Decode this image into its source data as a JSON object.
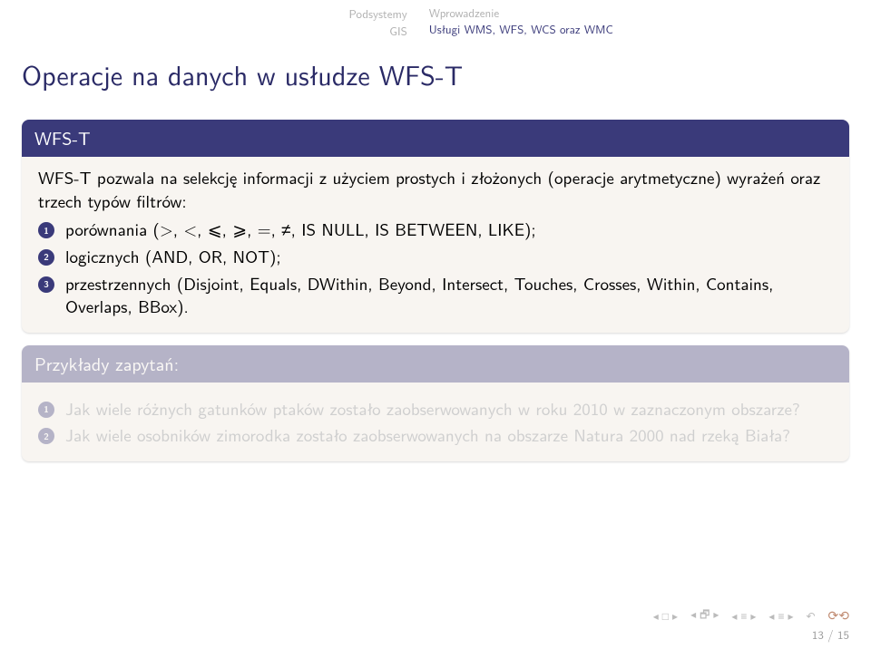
{
  "nav": {
    "left_line1": "Podsystemy",
    "left_line2": "GIS",
    "right_line1": "Wprowadzenie",
    "right_line2": "Usługi WMS, WFS, WCS oraz WMC"
  },
  "title": "Operacje na danych w usłudze WFS-T",
  "block1": {
    "title": "WFS-T",
    "intro": "WFS-T pozwala na selekcję informacji z użyciem prostych i złożonych (operacje arytmetyczne) wyrażeń oraz trzech typów filtrów:",
    "items": [
      "porównania (>, <, ⩽, ⩾, =, ≠, IS NULL, IS BETWEEN, LIKE);",
      "logicznych (AND, OR, NOT);",
      "przestrzennych (Disjoint, Equals, DWithin, Beyond, Intersect, Touches, Crosses, Within, Contains, Overlaps, BBox)."
    ]
  },
  "block2": {
    "title": "Przykłady zapytań:",
    "items": [
      "Jak wiele różnych gatunków ptaków zostało zaobserwowanych w roku 2010 w zaznaczonym obszarze?",
      "Jak wiele osobników zimorodka zostało zaobserwowanych na obszarze Natura 2000 nad rzeką Biała?"
    ]
  },
  "footer": "13 / 15",
  "bullets": {
    "n1": "1",
    "n2": "2",
    "n3": "3"
  }
}
